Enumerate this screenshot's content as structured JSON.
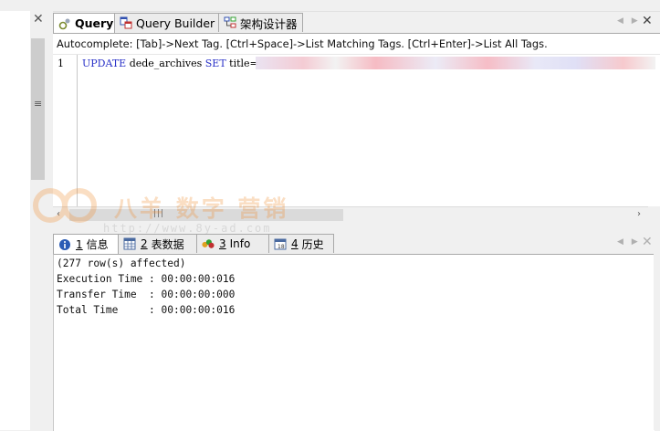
{
  "editor_tabs": [
    {
      "label": "Query",
      "icon": "query-icon",
      "active": true
    },
    {
      "label": "Query Builder",
      "icon": "query-builder-icon",
      "active": false
    },
    {
      "label": "架构设计器",
      "icon": "schema-designer-icon",
      "active": false
    }
  ],
  "editor": {
    "autocomplete_hint": "Autocomplete: [Tab]->Next Tag. [Ctrl+Space]->List Matching Tags. [Ctrl+Enter]->List All Tags.",
    "line_number": "1",
    "code": {
      "kw_update": "UPDATE",
      "table": "dede_archives",
      "kw_set": "SET",
      "assignment": "title="
    }
  },
  "result_tabs": [
    {
      "number": "1",
      "label": "信息",
      "icon": "info-icon",
      "active": true
    },
    {
      "number": "2",
      "label": "表数据",
      "icon": "table-data-icon",
      "active": false
    },
    {
      "number": "3",
      "label": "Info",
      "icon": "info-chart-icon",
      "active": false
    },
    {
      "number": "4",
      "label": "历史",
      "icon": "history-icon",
      "active": false
    }
  ],
  "results": {
    "lines": [
      "(277 row(s) affected)",
      "Execution Time : 00:00:00:016",
      "Transfer Time  : 00:00:00:000",
      "Total Time     : 00:00:00:016"
    ]
  },
  "watermark": {
    "text": "八羊 数字 营销",
    "url": "http://www.8y-ad.com"
  },
  "colors": {
    "keyword": "#2a32c8",
    "watermark": "#f08a2a"
  }
}
